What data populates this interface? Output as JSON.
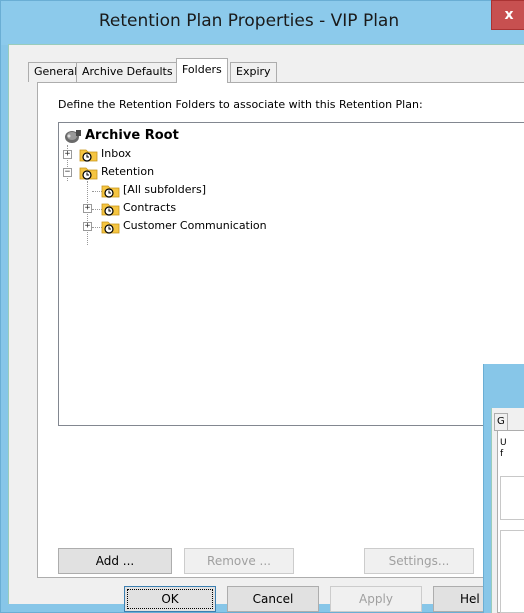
{
  "window": {
    "title": "Retention Plan Properties - VIP Plan",
    "close_label": "x"
  },
  "tabs": [
    {
      "label": "General",
      "active": false
    },
    {
      "label": "Archive Defaults",
      "active": false
    },
    {
      "label": "Folders",
      "active": true
    },
    {
      "label": "Expiry",
      "active": false
    }
  ],
  "folders_tab": {
    "instruction": "Define the Retention Folders to associate with this Retention Plan:",
    "tree": {
      "root": {
        "label": "Archive Root",
        "icon": "archive-root-icon"
      },
      "items": [
        {
          "label": "Inbox",
          "expander": "+",
          "icon": "retention-folder-icon"
        },
        {
          "label": "Retention",
          "expander": "−",
          "icon": "retention-folder-icon"
        },
        {
          "label": "[All subfolders]",
          "expander": "",
          "icon": "retention-folder-icon"
        },
        {
          "label": "Contracts",
          "expander": "+",
          "icon": "retention-folder-icon"
        },
        {
          "label": "Customer Communication",
          "expander": "+",
          "icon": "retention-folder-icon"
        }
      ]
    },
    "buttons": {
      "add": "Add ...",
      "remove": "Remove ...",
      "settings": "Settings..."
    }
  },
  "footer": {
    "ok": "OK",
    "cancel": "Cancel",
    "apply": "Apply",
    "help": "Hel"
  },
  "background_dialog": {
    "tab_label": "G",
    "line1": "U",
    "line2": "f"
  },
  "colors": {
    "titlebar": "#8ccaeb",
    "close_button": "#c75050",
    "folder": "#f5c542"
  }
}
